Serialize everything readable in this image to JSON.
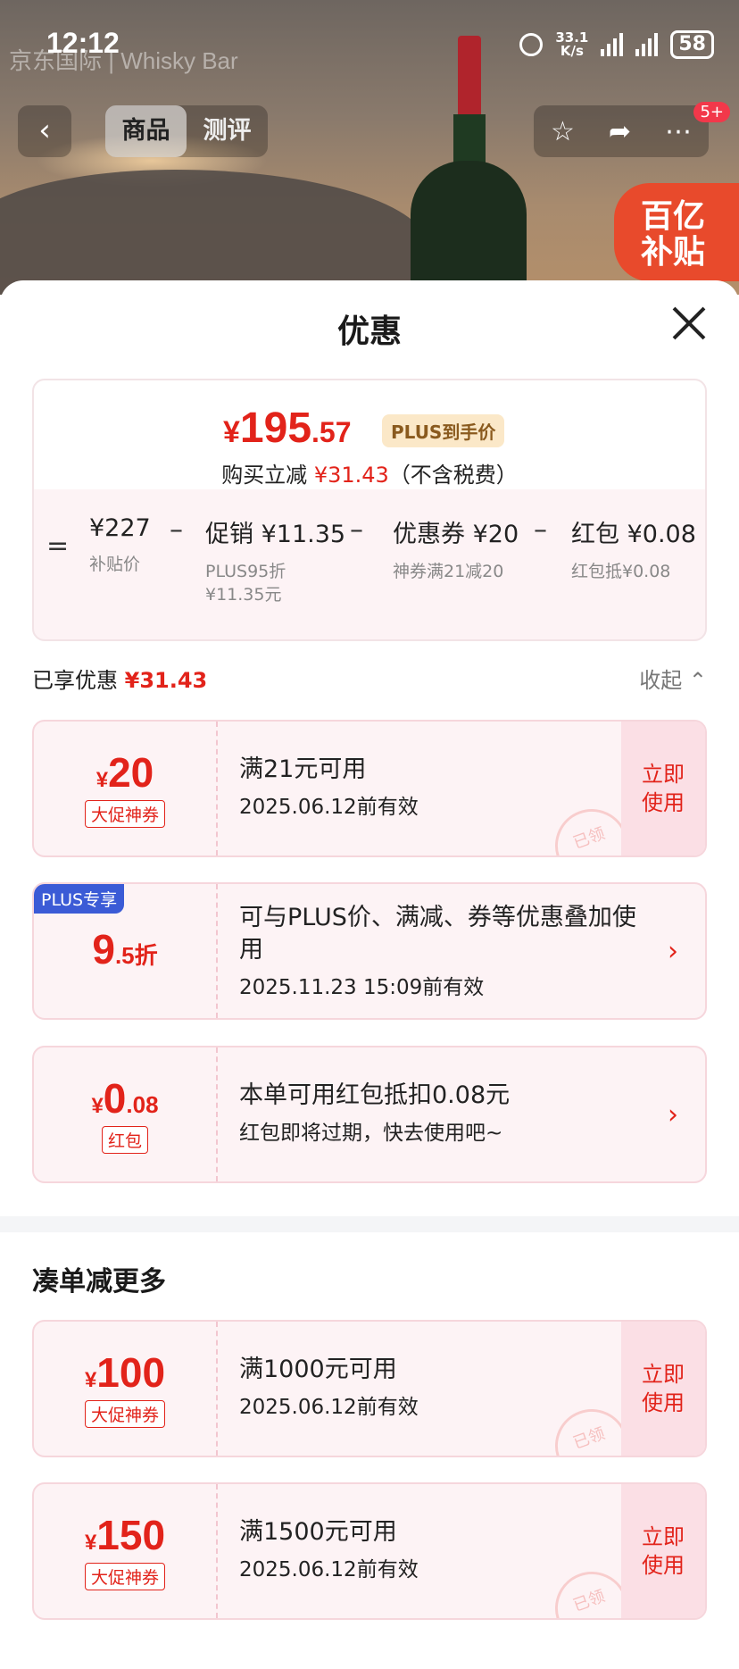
{
  "status_bar": {
    "time": "12:12",
    "net_top": "33.1",
    "net_bottom": "K/s",
    "battery": "58",
    "brand_watermark": "京东国际 | Whisky Bar"
  },
  "top_nav": {
    "back_icon": "chevron-left-icon",
    "tabs": [
      {
        "label": "商品",
        "active": true
      },
      {
        "label": "测评",
        "active": false
      }
    ],
    "actions": [
      "star-icon",
      "share-icon",
      "more-icon"
    ],
    "notification_badge": "5+",
    "subsidy_line1": "百亿",
    "subsidy_line2": "补贴"
  },
  "sheet": {
    "title": "优惠",
    "close_icon": "close-icon",
    "price": {
      "currency": "¥",
      "integer": "195",
      "decimal": ".57",
      "plus_tag": "PLUS到手价",
      "reduce_prefix": "购买立减",
      "reduce_amount": "¥31.43",
      "reduce_suffix": "（不含税费）"
    },
    "formula": [
      {
        "value": "¥227",
        "sub": "补贴价"
      },
      {
        "value": "促销 ¥11.35",
        "sub": "PLUS95折\n¥11.35元"
      },
      {
        "value": "优惠券 ¥20",
        "sub": "神券满21减20"
      },
      {
        "value": "红包 ¥0.08",
        "sub": "红包抵¥0.08"
      }
    ],
    "enjoyed_label": "已享优惠",
    "enjoyed_amount": "¥31.43",
    "collapse_label": "收起"
  },
  "coupons": [
    {
      "currency": "¥",
      "amount": "20",
      "decimal": "",
      "tag": "大促神券",
      "line1": "满21元可用",
      "line2": "2025.06.12前有效",
      "action": "立即\n使用",
      "stamp": "已领"
    },
    {
      "corner": "PLUS专享",
      "amount": "9",
      "decimal": ".5折",
      "line1": "可与PLUS价、满减、券等优惠叠加使用",
      "line2": "2025.11.23 15:09前有效"
    },
    {
      "currency": "¥",
      "amount": "0",
      "decimal": ".08",
      "tag": "红包",
      "line1": "本单可用红包抵扣0.08元",
      "line2": "红包即将过期，快去使用吧~"
    }
  ],
  "more_section": {
    "title": "凑单减更多",
    "coupons": [
      {
        "currency": "¥",
        "amount": "100",
        "tag": "大促神券",
        "line1": "满1000元可用",
        "line2": "2025.06.12前有效",
        "action": "立即\n使用",
        "stamp": "已领"
      },
      {
        "currency": "¥",
        "amount": "150",
        "tag": "大促神券",
        "line1": "满1500元可用",
        "line2": "2025.06.12前有效",
        "action": "立即\n使用",
        "stamp": "已领"
      }
    ]
  }
}
